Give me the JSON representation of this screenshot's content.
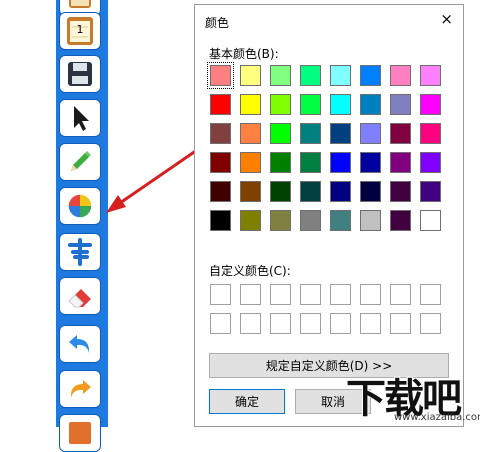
{
  "toolbar": {
    "page_number": "1",
    "tools": [
      {
        "name": "notebook-icon"
      },
      {
        "name": "page-icon"
      },
      {
        "name": "save-icon"
      },
      {
        "name": "pointer-icon"
      },
      {
        "name": "pencil-icon"
      },
      {
        "name": "color-palette-icon"
      },
      {
        "name": "text-book-icon"
      },
      {
        "name": "eraser-icon"
      },
      {
        "name": "undo-icon"
      },
      {
        "name": "redo-icon"
      },
      {
        "name": "image-icon"
      }
    ]
  },
  "dialog": {
    "title": "颜色",
    "close_label": "×",
    "basic_colors_label": "基本颜色(B):",
    "custom_colors_label": "自定义颜色(C):",
    "define_custom_label": "规定自定义颜色(D) >>",
    "ok_label": "确定",
    "cancel_label": "取消",
    "basic_colors": [
      [
        "#ff8080",
        "#ffff80",
        "#80ff80",
        "#00ff80",
        "#80ffff",
        "#0080ff",
        "#ff80c0",
        "#ff80ff"
      ],
      [
        "#ff0000",
        "#ffff00",
        "#80ff00",
        "#00ff40",
        "#00ffff",
        "#0080c0",
        "#8080c0",
        "#ff00ff"
      ],
      [
        "#804040",
        "#ff8040",
        "#00ff00",
        "#008080",
        "#004080",
        "#8080ff",
        "#800040",
        "#ff0080"
      ],
      [
        "#800000",
        "#ff8000",
        "#008000",
        "#008040",
        "#0000ff",
        "#0000a0",
        "#800080",
        "#8000ff"
      ],
      [
        "#400000",
        "#804000",
        "#004000",
        "#004040",
        "#000080",
        "#000040",
        "#400040",
        "#400080"
      ],
      [
        "#000000",
        "#808000",
        "#808040",
        "#808080",
        "#408080",
        "#c0c0c0",
        "#400040",
        "#ffffff"
      ]
    ],
    "selected_color": "#ff8080",
    "custom_colors_count": 16
  },
  "watermark": {
    "text": "下载吧",
    "url": "www.xiazaiba.com"
  }
}
